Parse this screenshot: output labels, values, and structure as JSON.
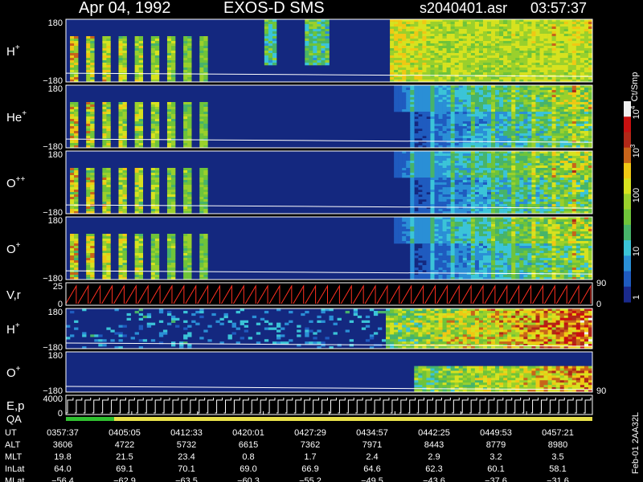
{
  "header": {
    "date": "Apr 04, 1992",
    "mission": "EXOS-D SMS",
    "file": "s2040401.asr",
    "time": "03:57:37"
  },
  "panels": [
    {
      "label": "H",
      "sup": "+",
      "ytop": "180",
      "ybot": "−180"
    },
    {
      "label": "He",
      "sup": "+",
      "ytop": "180",
      "ybot": "−180"
    },
    {
      "label": "O",
      "sup": "++",
      "ytop": "180",
      "ybot": "−180"
    },
    {
      "label": "O",
      "sup": "+",
      "ytop": "180",
      "ybot": "−180"
    },
    {
      "label": "V,r",
      "sup": "",
      "ytop": "25",
      "ybot": "0",
      "right_top": "90",
      "right_bot": "0"
    },
    {
      "label": "H",
      "sup": "+",
      "ytop": "180",
      "ybot": "−180"
    },
    {
      "label": "O",
      "sup": "+",
      "ytop": "180",
      "ybot": "−180",
      "right_bot": "90"
    },
    {
      "label": "E,p",
      "sup": "",
      "ytop": "4000",
      "ybot": "0"
    }
  ],
  "qa_label": "QA",
  "colorbar": {
    "title": "Ct/Smp",
    "tick_labels": [
      "1",
      "10",
      "100",
      "10",
      "10"
    ],
    "tick_sups": [
      "",
      "",
      "",
      "3",
      "4"
    ],
    "colors": [
      "#1a2a8c",
      "#1f5bbf",
      "#2a8fd6",
      "#3bc4d8",
      "#47b46a",
      "#6fc43a",
      "#9ad02c",
      "#d7e21f",
      "#f0c814",
      "#c8641a",
      "#b02818",
      "#c81010",
      "#f0f0f0"
    ]
  },
  "side_text": "Feb-01 2AA32L",
  "table": {
    "row_labels": [
      "UT",
      "ALT",
      "MLT",
      "InLat",
      "MLat"
    ],
    "columns": [
      [
        "0357:37",
        "3606",
        "19.8",
        "64.0",
        "−56.4"
      ],
      [
        "0405:05",
        "4722",
        "21.5",
        "69.1",
        "−62.9"
      ],
      [
        "0412:33",
        "5732",
        "23.4",
        "70.1",
        "−63.5"
      ],
      [
        "0420:01",
        "6615",
        "0.8",
        "69.0",
        "−60.3"
      ],
      [
        "0427:29",
        "7362",
        "1.7",
        "66.9",
        "−55.2"
      ],
      [
        "0434:57",
        "7971",
        "2.4",
        "64.6",
        "−49.5"
      ],
      [
        "0442:25",
        "8443",
        "2.9",
        "62.3",
        "−43.6"
      ],
      [
        "0449:53",
        "8779",
        "3.2",
        "60.1",
        "−37.6"
      ],
      [
        "0457:21",
        "8980",
        "3.5",
        "58.1",
        "−31.6"
      ]
    ]
  },
  "chart_data": {
    "type": "heatmap",
    "title": "Apr 04, 1992 EXOS-D SMS",
    "xlabel": "UT",
    "x_ticks": [
      "0357:37",
      "0405:05",
      "0412:33",
      "0420:01",
      "0427:29",
      "0434:57",
      "0442:25",
      "0449:53",
      "0457:21"
    ],
    "color_scale": "log",
    "color_range": [
      1,
      10000
    ],
    "colorbar_label": "Ct/Smp",
    "panels": [
      {
        "name": "H+",
        "ylim": [
          -180,
          180
        ]
      },
      {
        "name": "He+",
        "ylim": [
          -180,
          180
        ]
      },
      {
        "name": "O++",
        "ylim": [
          -180,
          180
        ]
      },
      {
        "name": "O+",
        "ylim": [
          -180,
          180
        ]
      },
      {
        "name": "V,r",
        "ylim": [
          0,
          25
        ],
        "right_ylim": [
          0,
          90
        ]
      },
      {
        "name": "H+",
        "ylim": [
          -180,
          180
        ]
      },
      {
        "name": "O+",
        "ylim": [
          -180,
          180
        ]
      },
      {
        "name": "E,p",
        "ylim": [
          0,
          4000
        ]
      }
    ]
  }
}
